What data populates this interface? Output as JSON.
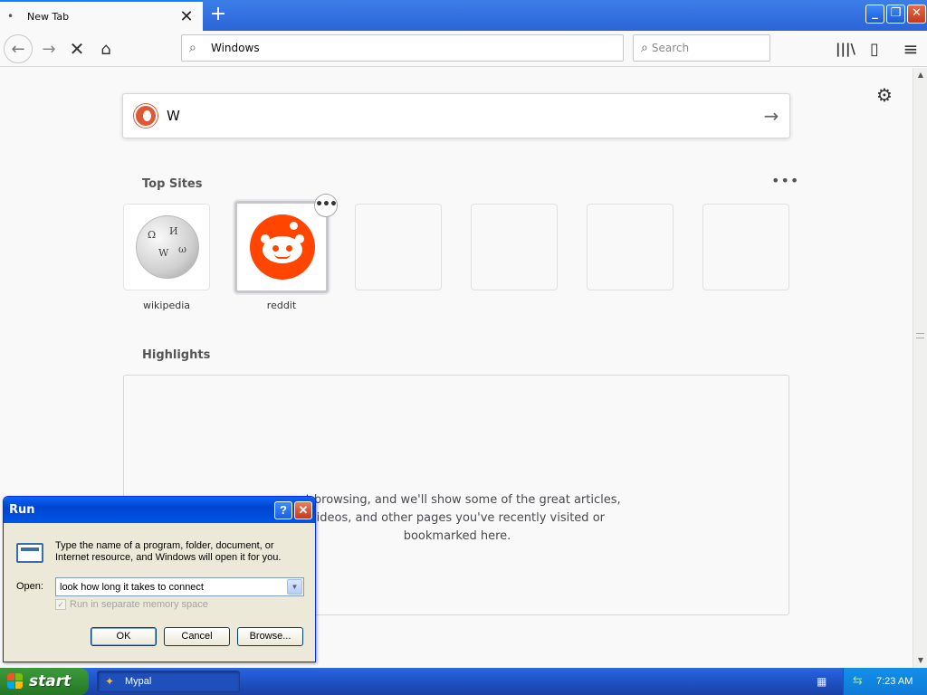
{
  "browser": {
    "tab": {
      "title": "New Tab",
      "favicon": "dot-icon"
    },
    "new_tab_label": "+",
    "window_controls": {
      "minimize": "_",
      "maximize": "❐",
      "close": "✕"
    },
    "nav": {
      "back_icon": "←",
      "forward_icon": "→",
      "stop_icon": "✕",
      "home_icon": "⌂",
      "library_icon": "|||\\",
      "sidebar_icon": "▯",
      "menu_icon": "≡"
    },
    "url_value": "Windows",
    "search_placeholder": "Search",
    "search_icon_glyph": "⌕"
  },
  "newtab": {
    "search_value": "W",
    "search_go": "→",
    "settings_icon": "⚙",
    "top_sites_title": "Top Sites",
    "more_icon": "•••",
    "sites": [
      {
        "label": "wikipedia",
        "icon": "wikipedia-globe"
      },
      {
        "label": "reddit",
        "icon": "reddit-alien"
      },
      {
        "label": ""
      },
      {
        "label": ""
      },
      {
        "label": ""
      },
      {
        "label": ""
      }
    ],
    "tile_menu_icon": "•••",
    "highlights_title": "Highlights",
    "highlights_empty_lines": [
      "art browsing, and we'll show some of the great articles,",
      "videos, and other pages you've recently visited or",
      "bookmarked here."
    ]
  },
  "run_dialog": {
    "title": "Run",
    "help": "?",
    "close": "✕",
    "description": "Type the name of a program, folder, document, or Internet resource, and Windows will open it for you.",
    "open_label": "Open:",
    "open_value": "look how long it takes to connect",
    "checkbox_label": "Run in separate memory space",
    "checkbox_checked": true,
    "ok": "OK",
    "cancel": "Cancel",
    "browse": "Browse..."
  },
  "taskbar": {
    "start_label": "start",
    "task_label": "Mypal",
    "clock": "7:23 AM"
  },
  "scrollbar": {
    "up": "▲",
    "down": "▼"
  },
  "colors": {
    "accent": "#0a84ff",
    "xp_blue": "#245edb",
    "start_green": "#2f8a2f",
    "reddit": "#ff4500"
  }
}
